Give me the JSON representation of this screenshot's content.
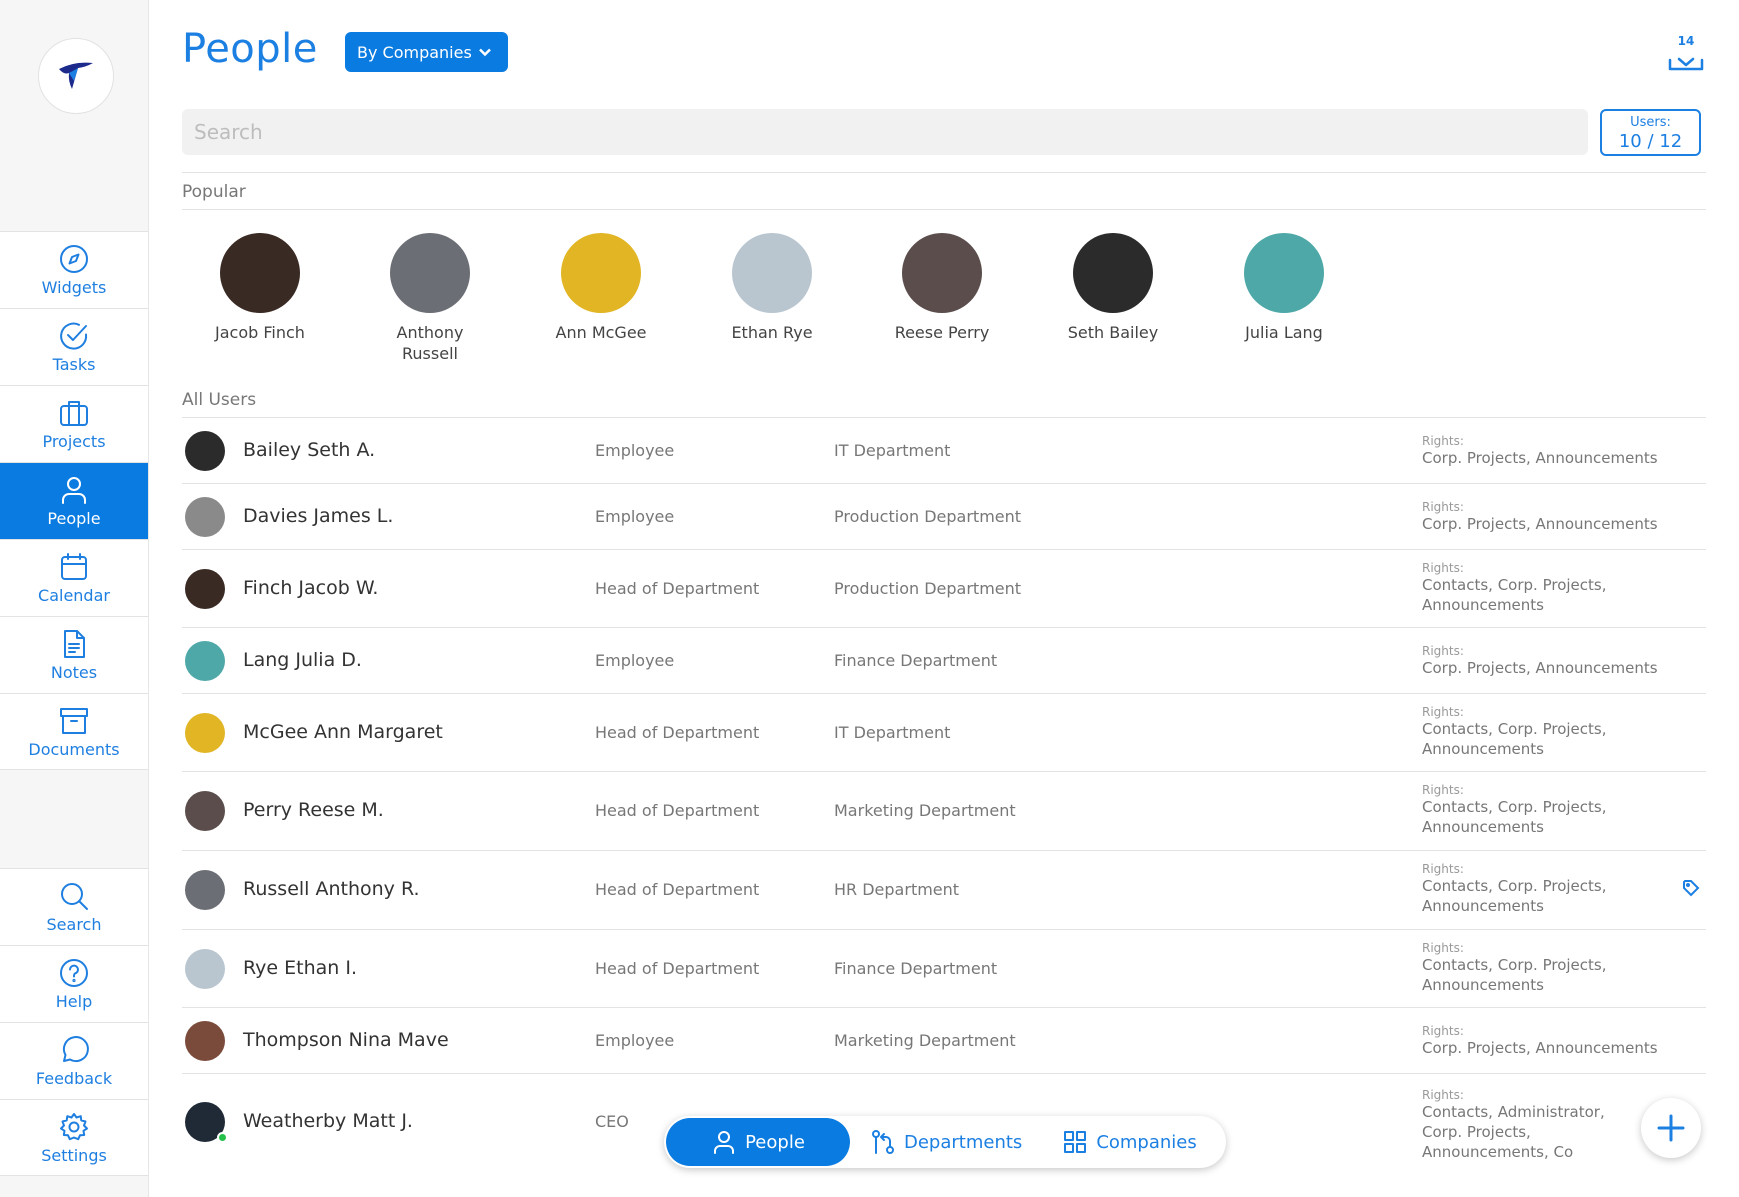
{
  "colors": {
    "accent": "#0a7be0",
    "sidebar_bg": "#f6f6f6",
    "online": "#25c04a"
  },
  "sidebar": {
    "logo_icon": "swift-logo-icon",
    "top_items": [
      {
        "label": "Widgets",
        "icon": "compass-icon"
      },
      {
        "label": "Tasks",
        "icon": "check-circle-icon"
      },
      {
        "label": "Projects",
        "icon": "briefcase-icon"
      },
      {
        "label": "People",
        "icon": "person-icon",
        "active": true
      },
      {
        "label": "Calendar",
        "icon": "calendar-icon"
      },
      {
        "label": "Notes",
        "icon": "document-icon"
      },
      {
        "label": "Documents",
        "icon": "archive-icon"
      }
    ],
    "bottom_items": [
      {
        "label": "Search",
        "icon": "search-icon"
      },
      {
        "label": "Help",
        "icon": "help-icon"
      },
      {
        "label": "Feedback",
        "icon": "chat-icon"
      },
      {
        "label": "Settings",
        "icon": "gear-icon"
      }
    ]
  },
  "header": {
    "title": "People",
    "filter_label": "By Companies",
    "download_count": "14"
  },
  "search": {
    "placeholder": "Search"
  },
  "users_counter": {
    "label": "Users:",
    "value": "10 / 12"
  },
  "popular": {
    "label": "Popular",
    "people": [
      {
        "name": "Jacob Finch",
        "avatar_color": "#3a2a24"
      },
      {
        "name": "Anthony Russell",
        "avatar_color": "#6b6e75"
      },
      {
        "name": "Ann McGee",
        "avatar_color": "#e1b523"
      },
      {
        "name": "Ethan Rye",
        "avatar_color": "#b9c6d0"
      },
      {
        "name": "Reese Perry",
        "avatar_color": "#5a4d4c"
      },
      {
        "name": "Seth Bailey",
        "avatar_color": "#2b2b2b"
      },
      {
        "name": "Julia Lang",
        "avatar_color": "#4fa8a8"
      }
    ]
  },
  "all_users": {
    "label": "All Users",
    "rights_label": "Rights:",
    "rows": [
      {
        "name": "Bailey Seth A.",
        "role": "Employee",
        "department": "IT Department",
        "rights": "Corp. Projects, Announcements",
        "avatar_color": "#2b2b2b"
      },
      {
        "name": "Davies James L.",
        "role": "Employee",
        "department": "Production Department",
        "rights": "Corp. Projects, Announcements",
        "avatar_color": "#8a8a8a"
      },
      {
        "name": "Finch Jacob W.",
        "role": "Head of Department",
        "department": "Production Department",
        "rights": "Contacts, Corp. Projects, Announcements",
        "avatar_color": "#3a2a24"
      },
      {
        "name": "Lang Julia D.",
        "role": "Employee",
        "department": "Finance Department",
        "rights": "Corp. Projects, Announcements",
        "avatar_color": "#4fa8a8"
      },
      {
        "name": "McGee Ann Margaret",
        "role": "Head of Department",
        "department": "IT Department",
        "rights": "Contacts, Corp. Projects, Announcements",
        "avatar_color": "#e1b523"
      },
      {
        "name": "Perry Reese M.",
        "role": "Head of Department",
        "department": "Marketing Department",
        "rights": "Contacts, Corp. Projects, Announcements",
        "avatar_color": "#5a4d4c"
      },
      {
        "name": "Russell Anthony R.",
        "role": "Head of Department",
        "department": "HR Department",
        "rights": "Contacts, Corp. Projects, Announcements",
        "avatar_color": "#6b6e75",
        "tagged": true
      },
      {
        "name": "Rye Ethan I.",
        "role": "Head of Department",
        "department": "Finance Department",
        "rights": "Contacts, Corp. Projects, Announcements",
        "avatar_color": "#b9c6d0"
      },
      {
        "name": "Thompson Nina Mave",
        "role": "Employee",
        "department": "Marketing Department",
        "rights": "Corp. Projects, Announcements",
        "avatar_color": "#7a4a3a"
      },
      {
        "name": "Weatherby Matt J.",
        "role": "CEO",
        "department": "",
        "rights": "Contacts, Administrator, Corp. Projects, Announcements, Co Calendars, Document Flow",
        "avatar_color": "#1f2a36",
        "online": true
      }
    ]
  },
  "bottom_tabs": [
    {
      "label": "People",
      "icon": "person-icon",
      "active": true
    },
    {
      "label": "Departments",
      "icon": "branch-icon"
    },
    {
      "label": "Companies",
      "icon": "grid-icon"
    }
  ],
  "fab_icon": "plus-icon"
}
